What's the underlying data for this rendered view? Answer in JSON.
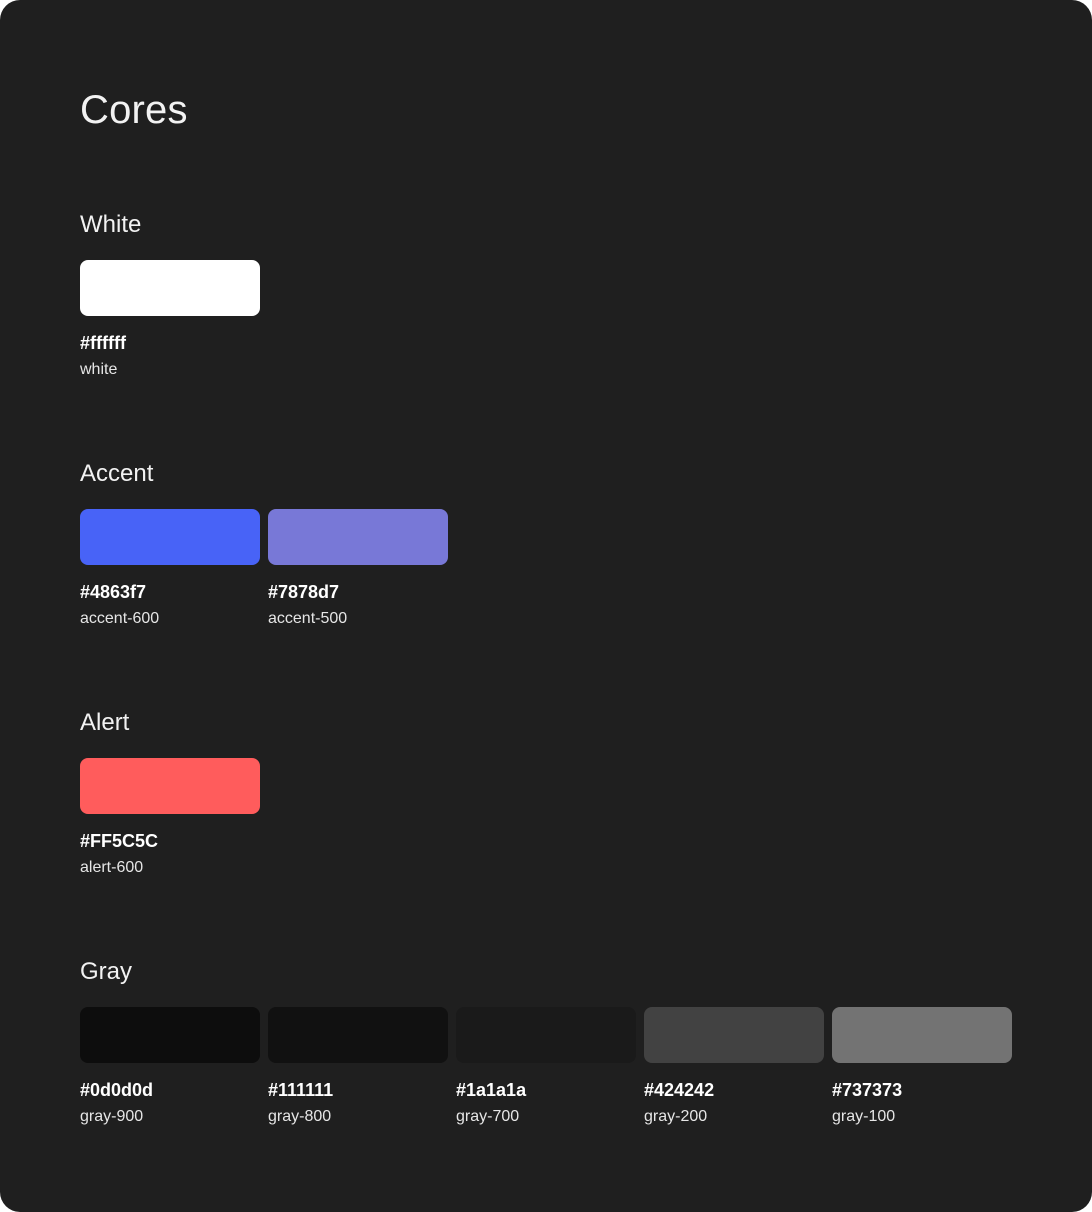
{
  "page_title": "Cores",
  "sections": [
    {
      "title": "White",
      "colors": [
        {
          "hex": "#ffffff",
          "name": "white",
          "value": "#ffffff"
        }
      ]
    },
    {
      "title": "Accent",
      "colors": [
        {
          "hex": "#4863f7",
          "name": "accent-600",
          "value": "#4863f7"
        },
        {
          "hex": "#7878d7",
          "name": "accent-500",
          "value": "#7878d7"
        }
      ]
    },
    {
      "title": "Alert",
      "colors": [
        {
          "hex": "#FF5C5C",
          "name": "alert-600",
          "value": "#FF5C5C"
        }
      ]
    },
    {
      "title": "Gray",
      "colors": [
        {
          "hex": "#0d0d0d",
          "name": "gray-900",
          "value": "#0d0d0d"
        },
        {
          "hex": "#111111",
          "name": "gray-800",
          "value": "#111111"
        },
        {
          "hex": "#1a1a1a",
          "name": "gray-700",
          "value": "#1a1a1a"
        },
        {
          "hex": "#424242",
          "name": "gray-200",
          "value": "#424242"
        },
        {
          "hex": "#737373",
          "name": "gray-100",
          "value": "#737373"
        }
      ]
    }
  ]
}
